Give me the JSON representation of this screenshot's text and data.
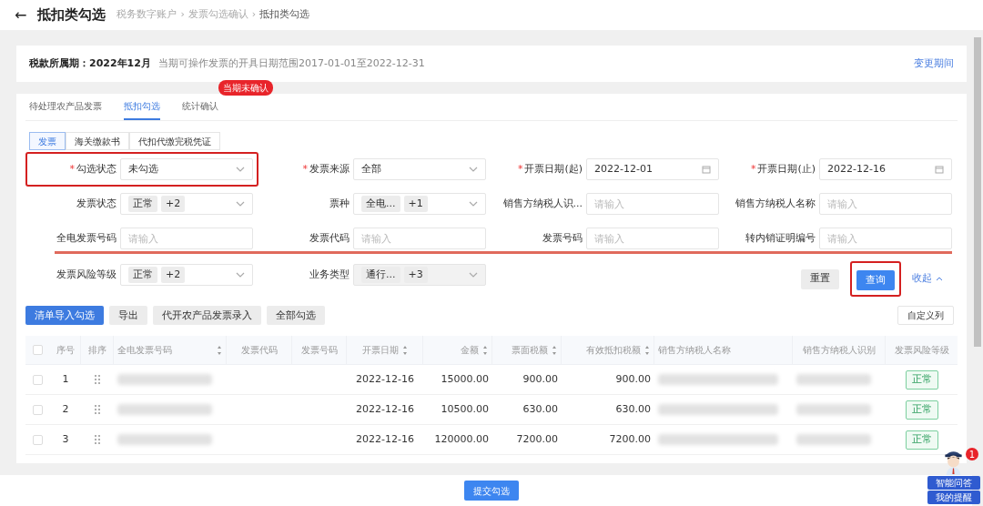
{
  "header": {
    "back": "←",
    "title": "抵扣类勾选",
    "breadcrumb": [
      "税务数字账户",
      "发票勾选确认",
      "抵扣类勾选"
    ],
    "separator": "›"
  },
  "required_mark": "*",
  "period": {
    "label": "税款所属期：2022年12月",
    "note": "当期可操作发票的开具日期范围2017-01-01至2022-12-31",
    "link": "变更期间"
  },
  "tabs": [
    {
      "label": "待处理农产品发票",
      "selected": false
    },
    {
      "label": "抵扣勾选",
      "selected": true
    },
    {
      "label": "统计确认",
      "selected": false,
      "badge": "当期未确认"
    }
  ],
  "subtabs": [
    {
      "label": "发票",
      "selected": true
    },
    {
      "label": "海关缴款书",
      "selected": false
    },
    {
      "label": "代扣代缴完税凭证",
      "selected": false
    }
  ],
  "filters": [
    {
      "label": "勾选状态",
      "required": true,
      "kind": "select",
      "value": "未勾选",
      "highlighted": true
    },
    {
      "label": "发票来源",
      "required": true,
      "kind": "select",
      "value": "全部",
      "highlighted": false
    },
    {
      "label": "开票日期(起)",
      "required": true,
      "kind": "date",
      "value": "2022-12-01",
      "highlighted": false
    },
    {
      "label": "开票日期(止)",
      "required": true,
      "kind": "date",
      "value": "2022-12-16",
      "highlighted": false
    },
    {
      "label": "发票状态",
      "required": false,
      "kind": "multi",
      "tags": [
        "正常",
        "+2"
      ],
      "highlighted": false
    },
    {
      "label": "票种",
      "required": false,
      "kind": "multi",
      "tags": [
        "全电...",
        "+1"
      ],
      "highlighted": false
    },
    {
      "label": "销售方纳税人识...",
      "required": false,
      "kind": "input",
      "placeholder": "请输入",
      "highlighted": false
    },
    {
      "label": "销售方纳税人名称",
      "required": false,
      "kind": "input",
      "placeholder": "请输入",
      "highlighted": false
    },
    {
      "label": "全电发票号码",
      "required": false,
      "kind": "input",
      "placeholder": "请输入",
      "highlighted": false
    },
    {
      "label": "发票代码",
      "required": false,
      "kind": "input",
      "placeholder": "请输入",
      "highlighted": false
    },
    {
      "label": "发票号码",
      "required": false,
      "kind": "input",
      "placeholder": "请输入",
      "highlighted": false
    },
    {
      "label": "转内销证明编号",
      "required": false,
      "kind": "input",
      "placeholder": "请输入",
      "highlighted": false
    },
    {
      "label": "发票风险等级",
      "required": false,
      "kind": "multi",
      "tags": [
        "正常",
        "+2"
      ],
      "highlighted": false
    },
    {
      "label": "业务类型",
      "required": false,
      "kind": "multi",
      "tags": [
        "通行...",
        "+3"
      ],
      "highlighted": false,
      "disabled": true
    }
  ],
  "form_buttons": [
    {
      "label": "重置",
      "kind": "default",
      "highlighted": false
    },
    {
      "label": "查询",
      "kind": "primary",
      "highlighted": true
    },
    {
      "label": "收起",
      "kind": "link",
      "highlighted": false
    }
  ],
  "toolbar": [
    {
      "label": "清单导入勾选",
      "kind": "primary"
    },
    {
      "label": "导出",
      "kind": "default"
    },
    {
      "label": "代开农产品发票录入",
      "kind": "default"
    },
    {
      "label": "全部勾选",
      "kind": "default"
    }
  ],
  "custom_columns": "自定义列",
  "table": {
    "header_checked": false,
    "columns": [
      {
        "label": "序号",
        "kind": "index",
        "sortable": false
      },
      {
        "label": "排序",
        "kind": "drag",
        "sortable": false
      },
      {
        "label": "全电发票号码",
        "kind": "redacted",
        "sortable": true
      },
      {
        "label": "发票代码",
        "kind": "text",
        "sortable": false
      },
      {
        "label": "发票号码",
        "kind": "text",
        "sortable": false
      },
      {
        "label": "开票日期",
        "kind": "text",
        "sortable": true
      },
      {
        "label": "金额",
        "kind": "number",
        "sortable": true
      },
      {
        "label": "票面税额",
        "kind": "number",
        "sortable": true
      },
      {
        "label": "有效抵扣税额",
        "kind": "number",
        "sortable": true
      },
      {
        "label": "销售方纳税人名称",
        "kind": "redacted",
        "sortable": false
      },
      {
        "label": "销售方纳税人识别",
        "kind": "redacted",
        "sortable": false
      },
      {
        "label": "发票风险等级",
        "kind": "tag",
        "sortable": false
      }
    ],
    "rows": [
      {
        "checked": false,
        "cells": [
          "1",
          "",
          "",
          "",
          "",
          "2022-12-16",
          "15000.00",
          "900.00",
          "900.00",
          "",
          "",
          "正常"
        ]
      },
      {
        "checked": false,
        "cells": [
          "2",
          "",
          "",
          "",
          "",
          "2022-12-16",
          "10500.00",
          "630.00",
          "630.00",
          "",
          "",
          "正常"
        ]
      },
      {
        "checked": false,
        "cells": [
          "3",
          "",
          "",
          "",
          "",
          "2022-12-16",
          "120000.00",
          "7200.00",
          "7200.00",
          "",
          "",
          "正常"
        ]
      }
    ]
  },
  "submit": "提交勾选",
  "assistant": {
    "badge": "1",
    "buttons": [
      "智能问答",
      "我的提醒"
    ]
  }
}
